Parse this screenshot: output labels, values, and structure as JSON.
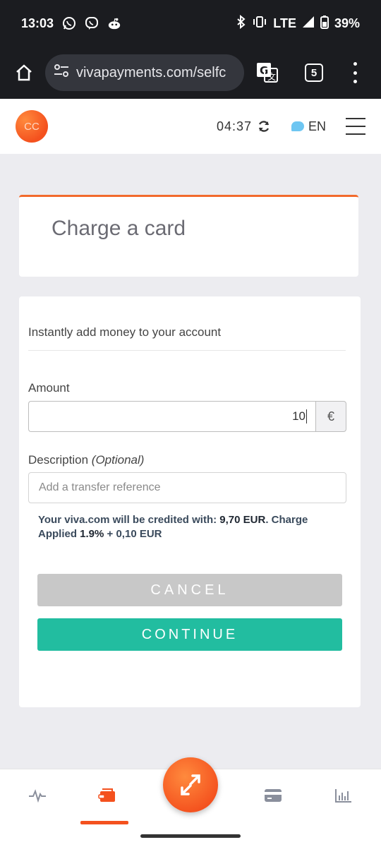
{
  "status_bar": {
    "time": "13:03",
    "network": "LTE",
    "battery": "39%",
    "icons": [
      "whatsapp-icon",
      "viber-icon",
      "reddit-icon",
      "bluetooth-icon",
      "vibrate-icon",
      "signal-icon",
      "battery-icon"
    ]
  },
  "browser": {
    "url": "vivapayments.com/selfc",
    "tab_count": "5",
    "icons": [
      "home-icon",
      "site-settings-icon",
      "translate-icon",
      "tabs-icon",
      "more-menu-icon"
    ]
  },
  "header": {
    "avatar_initials": "CC",
    "session_timer": "04:37",
    "language": "EN",
    "colors": {
      "brand": "#f4511e"
    }
  },
  "title_card": {
    "title": "Charge a card"
  },
  "form": {
    "subtitle": "Instantly add money to your account",
    "amount_label": "Amount",
    "amount_value": "10",
    "currency_symbol": "€",
    "description_label": "Description",
    "description_optional": "(Optional)",
    "description_placeholder": "Add a transfer reference",
    "credit_prefix": "Your viva.com will be credited with: ",
    "credit_amount": "9,70 EUR",
    "credit_mid": ". Charge Applied ",
    "charge_rate": "1.9%",
    "charge_fixed": " + 0,10 EUR",
    "cancel_label": "CANCEL",
    "continue_label": "CONTINUE",
    "colors": {
      "continue": "#22bda0",
      "cancel": "#c8c8c8"
    }
  },
  "bottom_nav": {
    "items": [
      "activity-icon",
      "wallet-icon",
      "transfer-icon",
      "card-icon",
      "reports-icon"
    ],
    "active": "wallet-icon"
  }
}
